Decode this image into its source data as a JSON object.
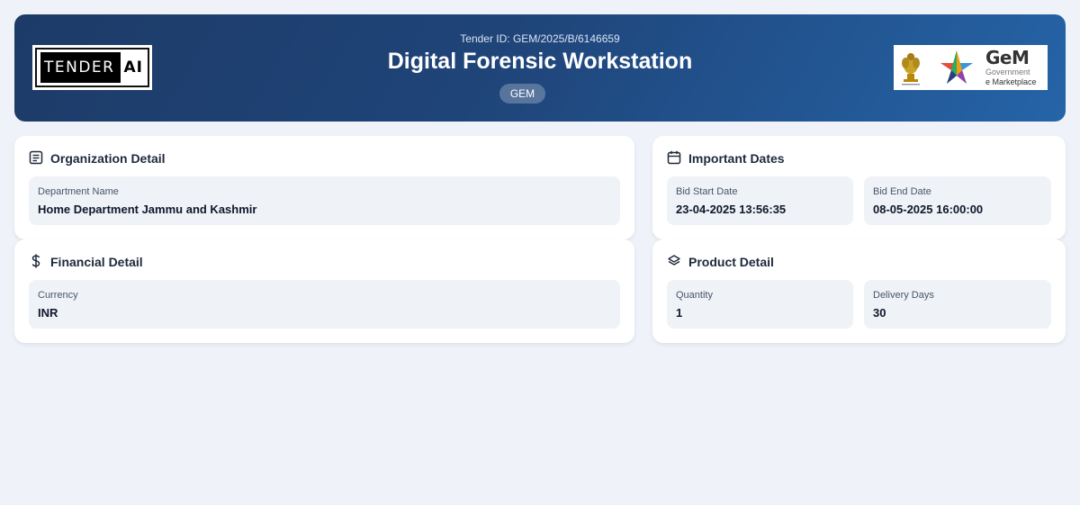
{
  "header": {
    "logo_left": {
      "word": "TENDER",
      "suffix": "AI"
    },
    "tender_id": "Tender ID: GEM/2025/B/6146659",
    "title": "Digital Forensic Workstation",
    "badge": "GEM",
    "logo_right": {
      "brand": "GeM",
      "line1": "Government",
      "line2": "e Marketplace"
    }
  },
  "organization": {
    "title": "Organization Detail",
    "icon": "list-icon",
    "fields": [
      {
        "label": "Department Name",
        "value": "Home Department Jammu and Kashmir"
      }
    ]
  },
  "dates": {
    "title": "Important Dates",
    "icon": "calendar-icon",
    "fields": [
      {
        "label": "Bid Start Date",
        "value": "23-04-2025 13:56:35"
      },
      {
        "label": "Bid End Date",
        "value": "08-05-2025 16:00:00"
      }
    ]
  },
  "financial": {
    "title": "Financial Detail",
    "icon": "dollar-icon",
    "fields": [
      {
        "label": "Currency",
        "value": "INR"
      }
    ]
  },
  "product": {
    "title": "Product Detail",
    "icon": "layers-icon",
    "fields": [
      {
        "label": "Quantity",
        "value": "1"
      },
      {
        "label": "Delivery Days",
        "value": "30"
      }
    ]
  },
  "colors": {
    "header_start": "#1d3b68",
    "header_end": "#2564a8",
    "page_bg": "#eff2f9",
    "field_bg": "#eff2f7"
  }
}
